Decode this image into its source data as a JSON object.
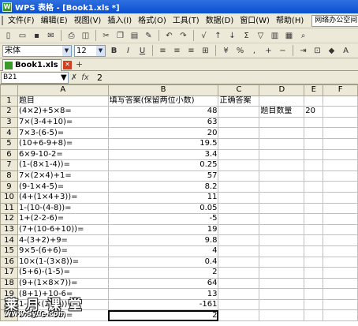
{
  "window": {
    "title": "WPS 表格 - [Book1.xls *]"
  },
  "menu": [
    "文件(F)",
    "编辑(E)",
    "视图(V)",
    "插入(I)",
    "格式(O)",
    "工具(T)",
    "数据(D)",
    "窗口(W)",
    "帮助(H)"
  ],
  "help_box": "网络办公空间",
  "format_bar": {
    "font_name": "宋体",
    "font_size": "12",
    "bold": "B",
    "italic": "I",
    "underline": "U"
  },
  "tab": {
    "label": "Book1.xls *"
  },
  "formula_bar": {
    "name_box": "B21",
    "cancel": "✗",
    "fx": "fx",
    "value": "2"
  },
  "columns": [
    "A",
    "B",
    "C",
    "D",
    "E",
    "F"
  ],
  "rows": [
    {
      "n": "1",
      "a": "题目",
      "b": "填写答案(保留两位小数)",
      "c": "正确答案",
      "d": "",
      "e": ""
    },
    {
      "n": "2",
      "a": "(4×2)+5×8=",
      "b": "48",
      "c": "",
      "d": "题目数量",
      "e": "20"
    },
    {
      "n": "3",
      "a": "7×(3-4+10)=",
      "b": "63",
      "c": "",
      "d": "",
      "e": ""
    },
    {
      "n": "4",
      "a": "7×3-(6-5)=",
      "b": "20",
      "c": "",
      "d": "",
      "e": ""
    },
    {
      "n": "5",
      "a": "(10+6-9+8)=",
      "b": "19.5",
      "c": "",
      "d": "",
      "e": ""
    },
    {
      "n": "6",
      "a": "6×9-10-2=",
      "b": "3.4",
      "c": "",
      "d": "",
      "e": ""
    },
    {
      "n": "7",
      "a": "(1-(8×1-4))=",
      "b": "0.25",
      "c": "",
      "d": "",
      "e": ""
    },
    {
      "n": "8",
      "a": "7×(2×4)+1=",
      "b": "57",
      "c": "",
      "d": "",
      "e": ""
    },
    {
      "n": "9",
      "a": "(9-1×4-5)=",
      "b": "8.2",
      "c": "",
      "d": "",
      "e": ""
    },
    {
      "n": "10",
      "a": "(4+(1×4+3))=",
      "b": "11",
      "c": "",
      "d": "",
      "e": ""
    },
    {
      "n": "11",
      "a": "1-(10-(4-8))=",
      "b": "0.05",
      "c": "",
      "d": "",
      "e": ""
    },
    {
      "n": "12",
      "a": "1+(2-2-6)=",
      "b": "-5",
      "c": "",
      "d": "",
      "e": ""
    },
    {
      "n": "13",
      "a": "(7+(10-6+10))=",
      "b": "19",
      "c": "",
      "d": "",
      "e": ""
    },
    {
      "n": "14",
      "a": "4-(3+2)+9=",
      "b": "9.8",
      "c": "",
      "d": "",
      "e": ""
    },
    {
      "n": "15",
      "a": "9×5-(6+6)=",
      "b": "4",
      "c": "",
      "d": "",
      "e": ""
    },
    {
      "n": "16",
      "a": "10×(1-(3×8))=",
      "b": "0.4",
      "c": "",
      "d": "",
      "e": ""
    },
    {
      "n": "17",
      "a": "(5+6)-(1-5)=",
      "b": "2",
      "c": "",
      "d": "",
      "e": ""
    },
    {
      "n": "18",
      "a": "(9+(1×8×7))=",
      "b": "64",
      "c": "",
      "d": "",
      "e": ""
    },
    {
      "n": "19",
      "a": "(8+1)+10-6=",
      "b": "13",
      "c": "",
      "d": "",
      "e": ""
    },
    {
      "n": "20",
      "a": "1-(6×(2×9))=",
      "b": "-161",
      "c": "",
      "d": "",
      "e": ""
    },
    {
      "n": "21",
      "a": "5×(3-5+10)=",
      "b": "2",
      "c": "",
      "d": "",
      "e": ""
    }
  ],
  "watermark": {
    "line1": "莱 月 课 堂",
    "line2": "www.Syue.com"
  }
}
